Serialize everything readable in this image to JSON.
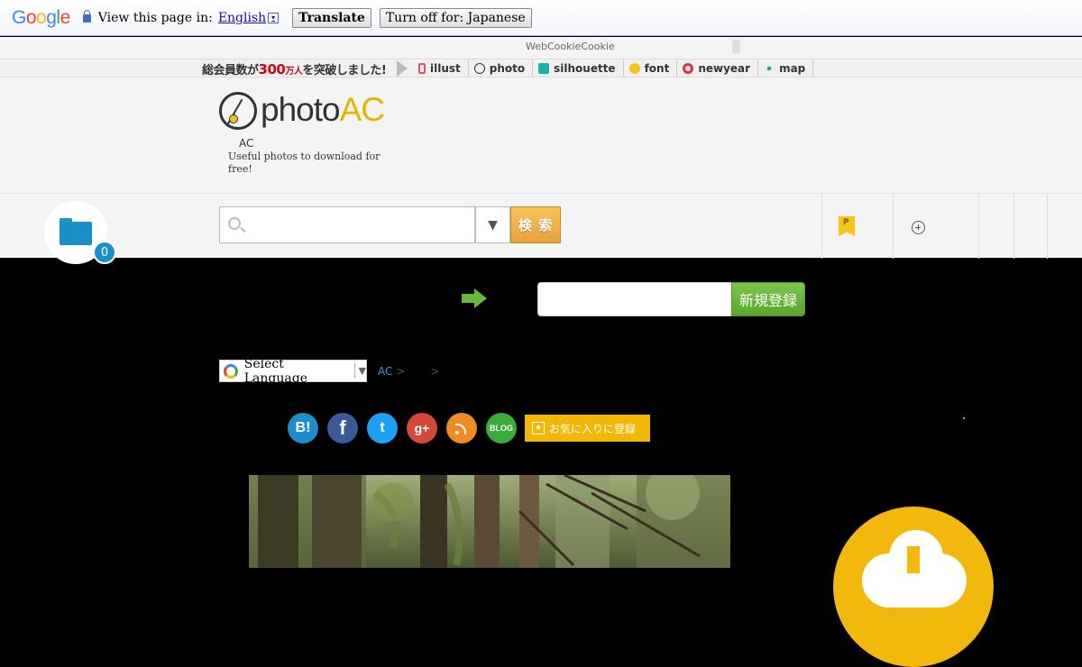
{
  "translate_bar": {
    "logo_letters": [
      "G",
      "o",
      "o",
      "g",
      "l",
      "e"
    ],
    "prompt": "View this page in:",
    "language": "English",
    "language_arrow": "▾",
    "translate_button": "Translate",
    "turn_off_button": "Turn off for: Japanese"
  },
  "cookie_notice": {
    "text": "WebCookieCookie"
  },
  "network_bar": {
    "members_pre": "総会員数が",
    "members_count": "300",
    "members_unit": "万人",
    "members_post": "を突破しました!",
    "items": [
      {
        "label": "illust",
        "icon": "illust-icon"
      },
      {
        "label": "photo",
        "icon": "photo-icon"
      },
      {
        "label": "silhouette",
        "icon": "silhouette-icon"
      },
      {
        "label": "font",
        "icon": "font-icon"
      },
      {
        "label": "newyear",
        "icon": "newyear-icon"
      },
      {
        "label": "map",
        "icon": "map-icon"
      }
    ]
  },
  "header": {
    "logo_word": "photo",
    "logo_accent": "AC",
    "site_label": "AC",
    "tagline": "Useful photos to download for free!"
  },
  "nav": {
    "folder_count": "0",
    "search_placeholder": "",
    "dropdown_arrow": "▼",
    "search_button": "検 索",
    "point_icon_letter": "P"
  },
  "signup": {
    "input_placeholder": "",
    "button": "新規登録"
  },
  "language_select": {
    "label": "Select Language",
    "arrow": "▼"
  },
  "breadcrumb": {
    "home": "AC",
    "sep1": ">",
    "sep2": ">"
  },
  "social": {
    "hatena": "B!",
    "facebook": "f",
    "twitter": "t",
    "googleplus": "g+",
    "blog": "BLOG",
    "favorite_icon": "★",
    "favorite_button": "お気に入りに登録"
  },
  "colors": {
    "accent_yellow": "#f2b90c",
    "folder_blue": "#1b8fc8",
    "signup_green": "#5aa62f",
    "search_orange": "#e9a23d"
  }
}
